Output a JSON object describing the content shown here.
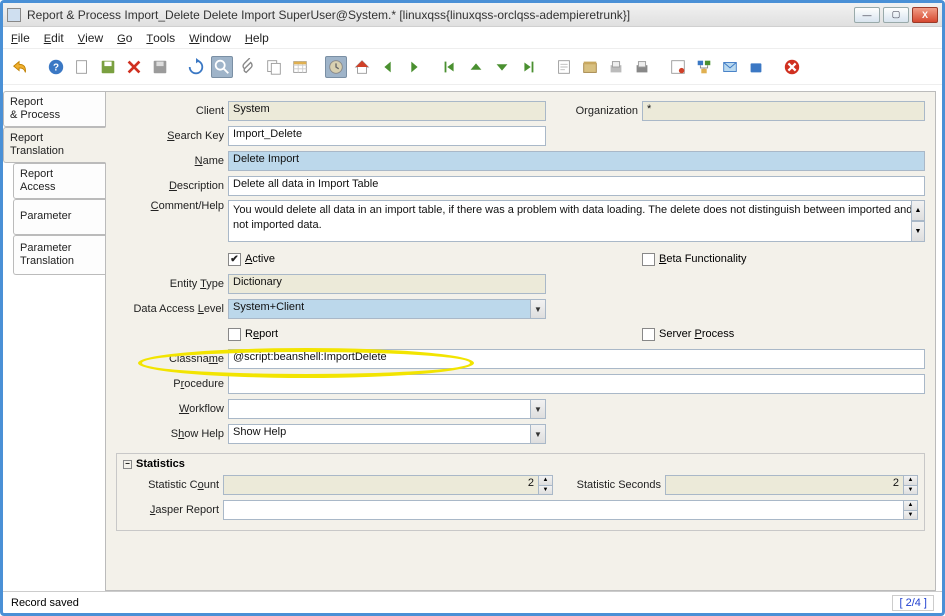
{
  "window": {
    "title": "Report & Process  Import_Delete  Delete Import   SuperUser@System.*  [linuxqss{linuxqss-orclqss-adempieretrunk}]"
  },
  "menu": {
    "file": "File",
    "edit": "Edit",
    "view": "View",
    "go": "Go",
    "tools": "Tools",
    "window": "Window",
    "help": "Help"
  },
  "tabs": [
    {
      "label": "Report\n& Process",
      "active": false,
      "indent": false
    },
    {
      "label": "Report\nTranslation",
      "active": true,
      "indent": false
    },
    {
      "label": "Report\nAccess",
      "active": false,
      "indent": true
    },
    {
      "label": "Parameter",
      "active": false,
      "indent": true
    },
    {
      "label": "Parameter\nTranslation",
      "active": false,
      "indent": true
    }
  ],
  "fields": {
    "client_label": "Client",
    "client_value": "System",
    "organization_label": "Organization",
    "organization_value": "*",
    "searchkey_label": "Search Key",
    "searchkey_value": "Import_Delete",
    "name_label": "Name",
    "name_value": "Delete Import",
    "description_label": "Description",
    "description_value": "Delete all data in Import Table",
    "comment_label": "Comment/Help",
    "comment_value": "You would delete all data in an import table, if there was a problem with data loading.  The delete does not distinguish between imported and not imported data.",
    "active_label": "Active",
    "beta_label": "Beta Functionality",
    "entitytype_label": "Entity Type",
    "entitytype_value": "Dictionary",
    "dal_label": "Data Access Level",
    "dal_value": "System+Client",
    "report_label": "Report",
    "serverprocess_label": "Server Process",
    "classname_label": "Classname",
    "classname_value": "@script:beanshell:ImportDelete",
    "procedure_label": "Procedure",
    "procedure_value": "",
    "workflow_label": "Workflow",
    "workflow_value": "",
    "showhelp_label": "Show Help",
    "showhelp_value": "Show Help",
    "statistics_title": "Statistics",
    "statcount_label": "Statistic Count",
    "statcount_value": "2",
    "statseconds_label": "Statistic Seconds",
    "statseconds_value": "2",
    "jasper_label": "Jasper Report",
    "jasper_value": ""
  },
  "status": {
    "message": "Record saved",
    "position": "[  2/4  ]"
  }
}
